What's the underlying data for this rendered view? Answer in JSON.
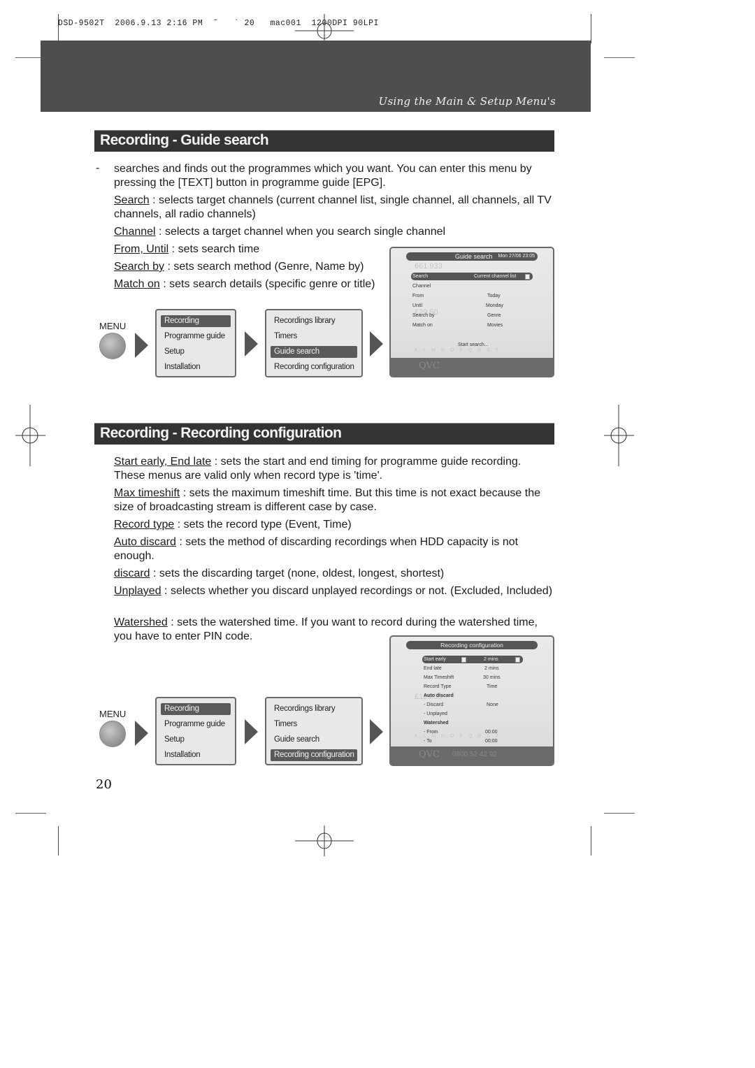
{
  "print_slug": "DSD-9502T  2006.9.13 2:16 PM  ˜   ` 20   mac001  1200DPI 90LPI",
  "banner": {
    "title": "Using the Main & Setup Menu's"
  },
  "sections": [
    {
      "heading": "Recording - Guide search",
      "intro": "searches and finds out the programmes which you want. You can enter this menu by pressing the [TEXT] button in programme guide [EPG].",
      "bullet": "-",
      "items": [
        {
          "term": "Search",
          "text": " : selects target channels (current channel list, single channel,  all channels, all TV channels, all radio channels)"
        },
        {
          "term": "Channel",
          "text": " : selects a target channel when you search single channel"
        },
        {
          "term": "From, Until",
          "text": " : sets search time"
        },
        {
          "term": "Search by",
          "text": " : sets search method (Genre, Name by)"
        },
        {
          "term": "Match on",
          "text": " : sets  search details (specific genre or title)"
        }
      ],
      "menu_flow": {
        "menu_label": "MENU",
        "main_menu": [
          "Recording",
          "Programme guide",
          "Setup",
          "Installation"
        ],
        "main_selected": 0,
        "sub_menu": [
          "Recordings library",
          "Timers",
          "Guide search",
          "Recording configuration"
        ],
        "sub_selected": 2
      },
      "screen": {
        "title": "Guide search",
        "datetime": "Mon 27/06 23:05",
        "rows": [
          {
            "label": "Search",
            "value": "Current channel list",
            "selected": true
          },
          {
            "label": "Channel",
            "value": ""
          },
          {
            "label": "From",
            "value": "Today"
          },
          {
            "label": "Until",
            "value": "Monday"
          },
          {
            "label": "Search by",
            "value": "Genre"
          },
          {
            "label": "Match on",
            "value": "Movies"
          }
        ],
        "action": "Start search...",
        "background_text": {
          "channel_code": "661 933",
          "price": "£29.50",
          "letters": "K L M N O P Q R S T",
          "logo": "QVC"
        }
      }
    },
    {
      "heading": "Recording - Recording configuration",
      "items": [
        {
          "term": "Start early, End late",
          "text": " : sets the start and end timing for programme guide recording. These menus are valid only when record type is 'time'."
        },
        {
          "term": "Max timeshift",
          "text": " : sets the maximum timeshift time. But this time is not exact because the size of broadcasting stream is different case by case."
        },
        {
          "term": "Record type",
          "text": " : sets the record type (Event, Time)"
        },
        {
          "term": "Auto discard",
          "text": " : sets the method of discarding recordings when HDD capacity is not enough."
        },
        {
          "term": "discard",
          "text": " : sets the discarding target (none, oldest, longest, shortest)"
        },
        {
          "term": "Unplayed",
          "text": " : selects whether you discard unplayed recordings or not. (Excluded, Included)"
        },
        {
          "term": "Watershed",
          "text": " : sets the watershed time. If you want to record during the watershed time, you have to enter PIN code."
        }
      ],
      "menu_flow": {
        "menu_label": "MENU",
        "main_menu": [
          "Recording",
          "Programme guide",
          "Setup",
          "Installation"
        ],
        "main_selected": 0,
        "sub_menu": [
          "Recordings library",
          "Timers",
          "Guide search",
          "Recording configuration"
        ],
        "sub_selected": 3
      },
      "screen": {
        "title": "Recording configuration",
        "rows": [
          {
            "label": "Start early",
            "value": "2 mins",
            "selected": true
          },
          {
            "label": "End late",
            "value": "2 mins"
          },
          {
            "label": "Max Timeshift",
            "value": "30 mins"
          },
          {
            "label": "Record Type",
            "value": "Time"
          },
          {
            "label": "Auto discard",
            "value": "",
            "group": true
          },
          {
            "label": "- Discard",
            "value": "None"
          },
          {
            "label": "- Unplayed",
            "value": ""
          },
          {
            "label": "Watershed",
            "value": "",
            "group": true
          },
          {
            "label": "- From",
            "value": "00:00"
          },
          {
            "label": "- To",
            "value": "00:00"
          }
        ],
        "background_text": {
          "price": "£129.50",
          "letters": "K L M N O P Q R S T",
          "logo": "QVC",
          "phone": "0800 52 42 92"
        }
      }
    }
  ],
  "page_number": "20"
}
